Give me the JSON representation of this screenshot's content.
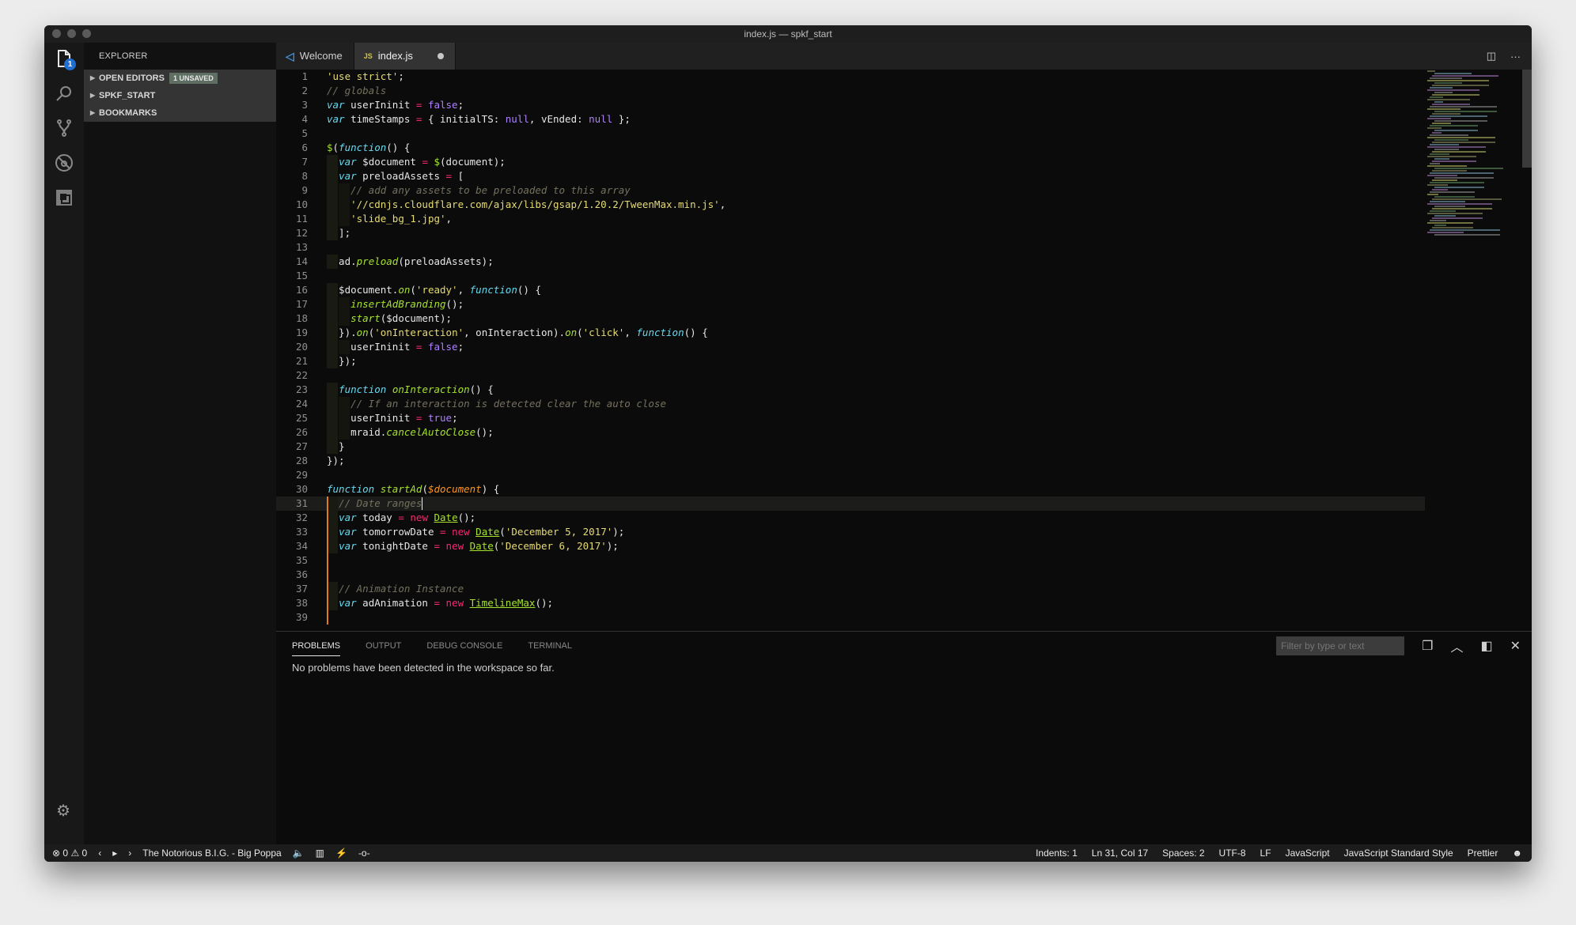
{
  "window": {
    "title": "index.js — spkf_start"
  },
  "activity_bar": {
    "items": [
      {
        "name": "explorer",
        "badge": "1"
      },
      {
        "name": "search"
      },
      {
        "name": "source-control"
      },
      {
        "name": "debug"
      },
      {
        "name": "extensions"
      }
    ]
  },
  "sidebar": {
    "title": "EXPLORER",
    "sections": [
      {
        "label": "OPEN EDITORS",
        "badge": "1 UNSAVED"
      },
      {
        "label": "SPKF_START"
      },
      {
        "label": "BOOKMARKS"
      }
    ]
  },
  "tabs": [
    {
      "label": "Welcome",
      "icon": "vscode-icon",
      "active": false
    },
    {
      "label": "index.js",
      "icon": "JS",
      "active": true,
      "dirty": true
    }
  ],
  "tab_actions": {
    "split": "split-editor-icon",
    "more": "···"
  },
  "code": {
    "lines": [
      "'use strict';",
      "// globals",
      "var userIninit = false;",
      "var timeStamps = { initialTS: null, vEnded: null };",
      "",
      "$(function() {",
      "  var $document = $(document);",
      "  var preloadAssets = [",
      "    // add any assets to be preloaded to this array",
      "    '//cdnjs.cloudflare.com/ajax/libs/gsap/1.20.2/TweenMax.min.js',",
      "    'slide_bg_1.jpg',",
      "  ];",
      "",
      "  ad.preload(preloadAssets);",
      "",
      "  $document.on('ready', function() {",
      "    insertAdBranding();",
      "    start($document);",
      "  }).on('onInteraction', onInteraction).on('click', function() {",
      "    userIninit = false;",
      "  });",
      "",
      "  function onInteraction() {",
      "    // If an interaction is detected clear the auto close",
      "    userIninit = true;",
      "    mraid.cancelAutoClose();",
      "  }",
      "});",
      "",
      "function startAd($document) {",
      "  // Date ranges",
      "  var today = new Date();",
      "  var tomorrowDate = new Date('December 5, 2017');",
      "  var tonightDate = new Date('December 6, 2017');",
      "",
      "",
      "  // Animation Instance",
      "  var adAnimation = new TimelineMax();",
      ""
    ],
    "current_line": 31
  },
  "panel": {
    "tabs": [
      "PROBLEMS",
      "OUTPUT",
      "DEBUG CONSOLE",
      "TERMINAL"
    ],
    "active_tab": "PROBLEMS",
    "filter_placeholder": "Filter by type or text",
    "message": "No problems have been detected in the workspace so far."
  },
  "status_bar": {
    "errors": "0",
    "warnings": "0",
    "now_playing": "The Notorious B.I.G. - Big Poppa",
    "indents": "Indents: 1",
    "position": "Ln 31, Col 17",
    "spaces": "Spaces: 2",
    "encoding": "UTF-8",
    "eol": "LF",
    "language": "JavaScript",
    "linter": "JavaScript Standard Style",
    "formatter": "Prettier"
  }
}
